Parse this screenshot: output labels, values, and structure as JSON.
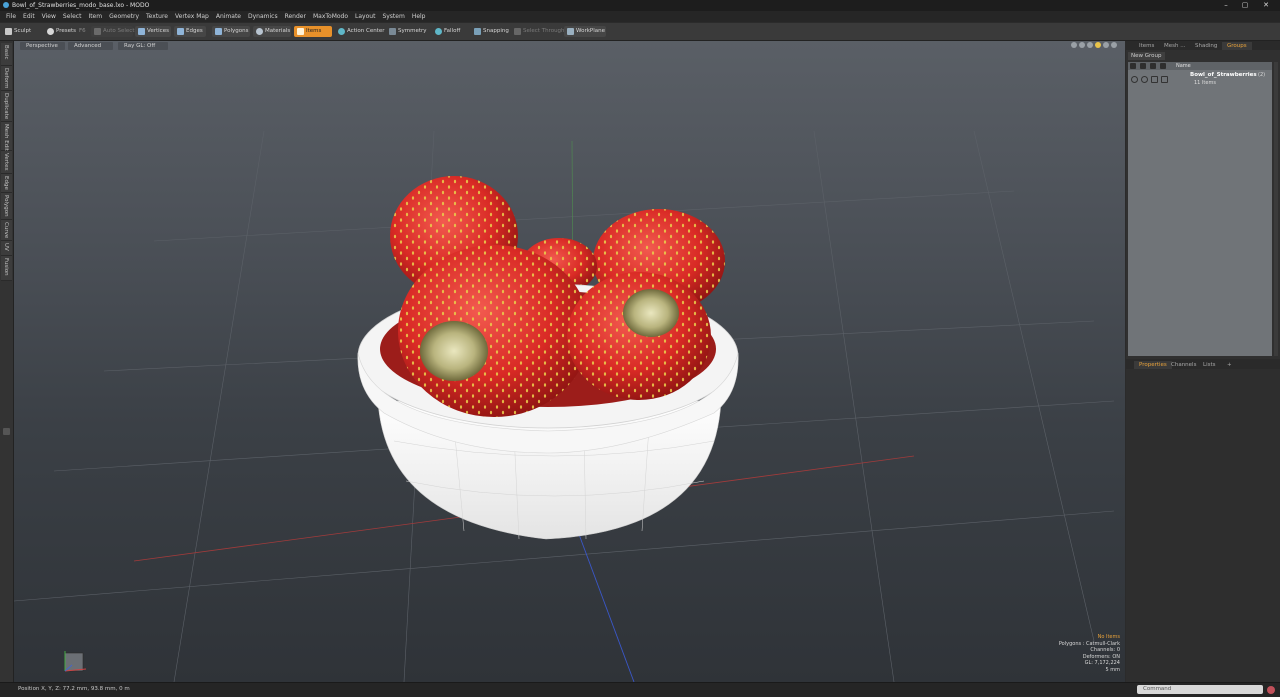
{
  "window": {
    "title": "Bowl_of_Strawberries_modo_base.lxo - MODO",
    "controls": [
      "–",
      "▢",
      "✕"
    ]
  },
  "menu": [
    "File",
    "Edit",
    "View",
    "Select",
    "Item",
    "Geometry",
    "Texture",
    "Vertex Map",
    "Animate",
    "Dynamics",
    "Render",
    "MaxToModo",
    "Layout",
    "System",
    "Help"
  ],
  "toolbar": {
    "sculpt": "Sculpt",
    "presets": "Presets",
    "presets_key": "F6",
    "auto_select": "Auto Select",
    "vertices": "Vertices",
    "edges": "Edges",
    "polygons": "Polygons",
    "materials": "Materials",
    "items": "Items",
    "action_center": "Action Center",
    "symmetry": "Symmetry",
    "falloff": "Falloff",
    "snapping": "Snapping",
    "select_through": "Select Through",
    "workplane": "WorkPlane",
    "accent": "#e8912a"
  },
  "left_tabs": [
    "Basic",
    "Deform",
    "Duplicate",
    "Mesh Edit",
    "Vertex",
    "Edge",
    "Polygon",
    "Curve",
    "UV",
    "Fusion"
  ],
  "viewport": {
    "view": "Perspective",
    "shading": "Advanced",
    "ray_gl": "Ray GL: Off",
    "stats": {
      "selection": "No Items",
      "polygons": "Polygons : Catmull-Clark",
      "channels": "Channels: 0",
      "deformers": "Deformers: ON",
      "gl": "GL: 7,172,224",
      "grid": "5 mm"
    }
  },
  "groups_panel": {
    "tabs": [
      "Items",
      "Mesh ...",
      "Shading",
      "Groups"
    ],
    "active_tab": "Groups",
    "new_group": "New Group",
    "column_name": "Name",
    "group": {
      "name": "Bowl_of_Strawberries",
      "count": "(2)",
      "items": "11 Items"
    }
  },
  "properties_panel": {
    "tabs": [
      "Properties",
      "Channels",
      "Lists"
    ],
    "active_tab": "Properties",
    "add": "+"
  },
  "statusbar": {
    "position": "Position X, Y, Z:   77.2 mm, 93.8 mm, 0 m",
    "command_placeholder": "Command"
  }
}
